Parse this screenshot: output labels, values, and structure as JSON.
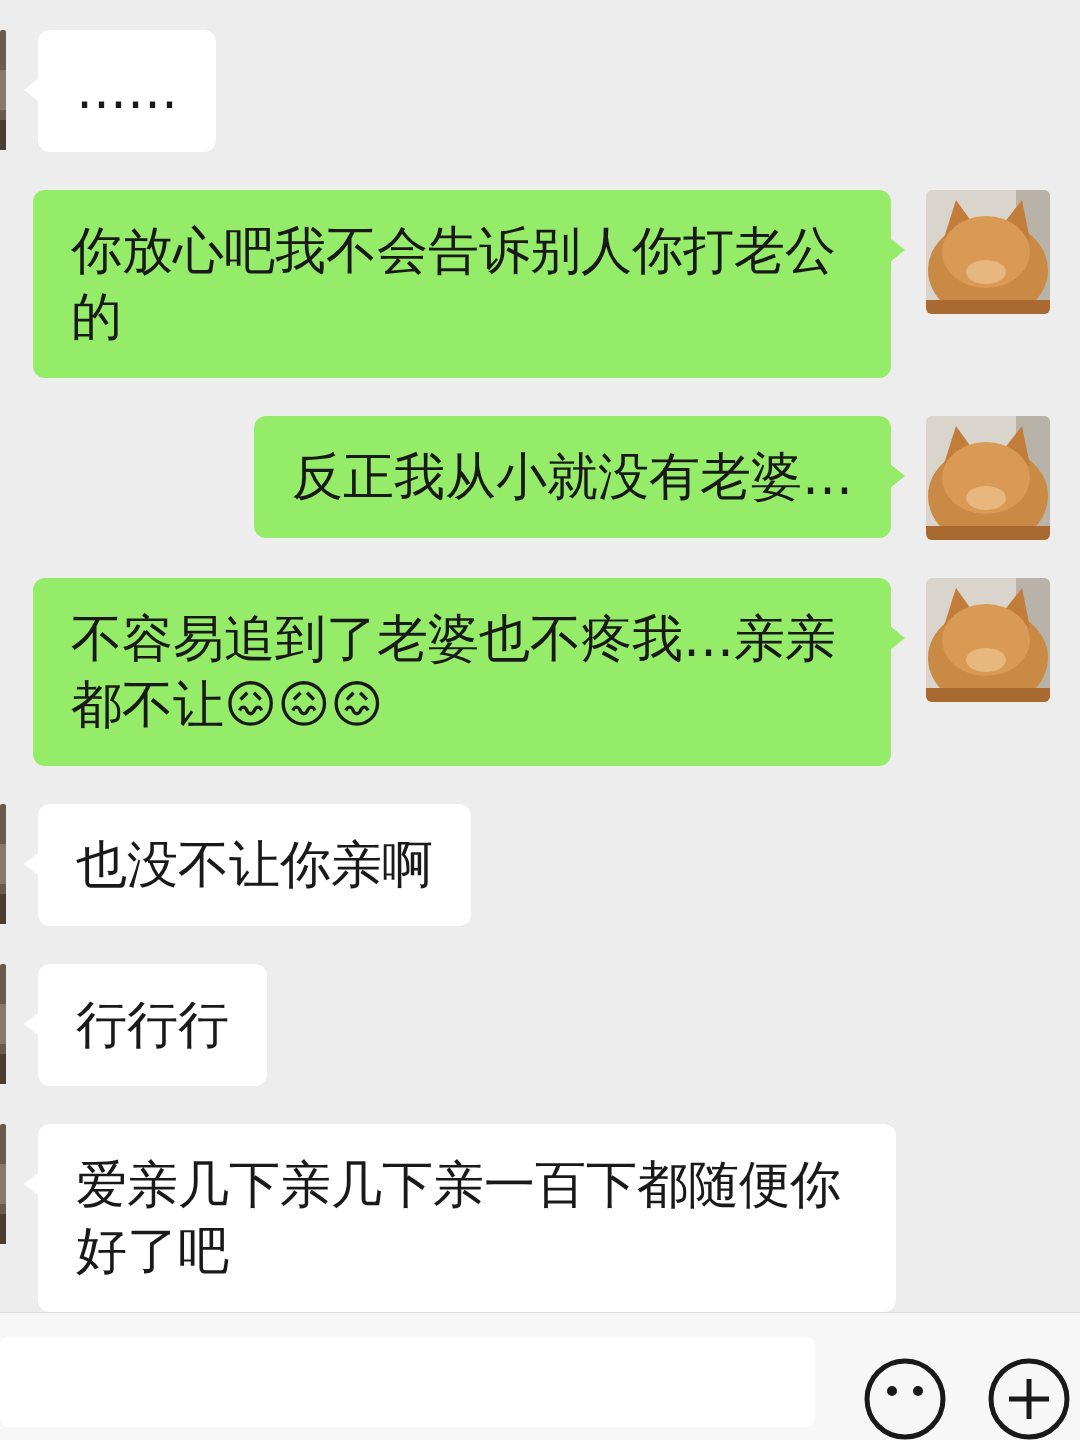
{
  "messages": [
    {
      "kind": "received",
      "text": "……"
    },
    {
      "kind": "sent",
      "text": "你放心吧我不会告诉别人你打老公的"
    },
    {
      "kind": "sent",
      "text": "反正我从小就没有老婆…"
    },
    {
      "kind": "sent",
      "text": "不容易追到了老婆也不疼我…亲亲都不让😖😖😖"
    },
    {
      "kind": "received",
      "text": "也没不让你亲啊"
    },
    {
      "kind": "received",
      "text": "行行行"
    },
    {
      "kind": "received",
      "text": "爱亲几下亲几下亲一百下都随便你好了吧"
    }
  ]
}
